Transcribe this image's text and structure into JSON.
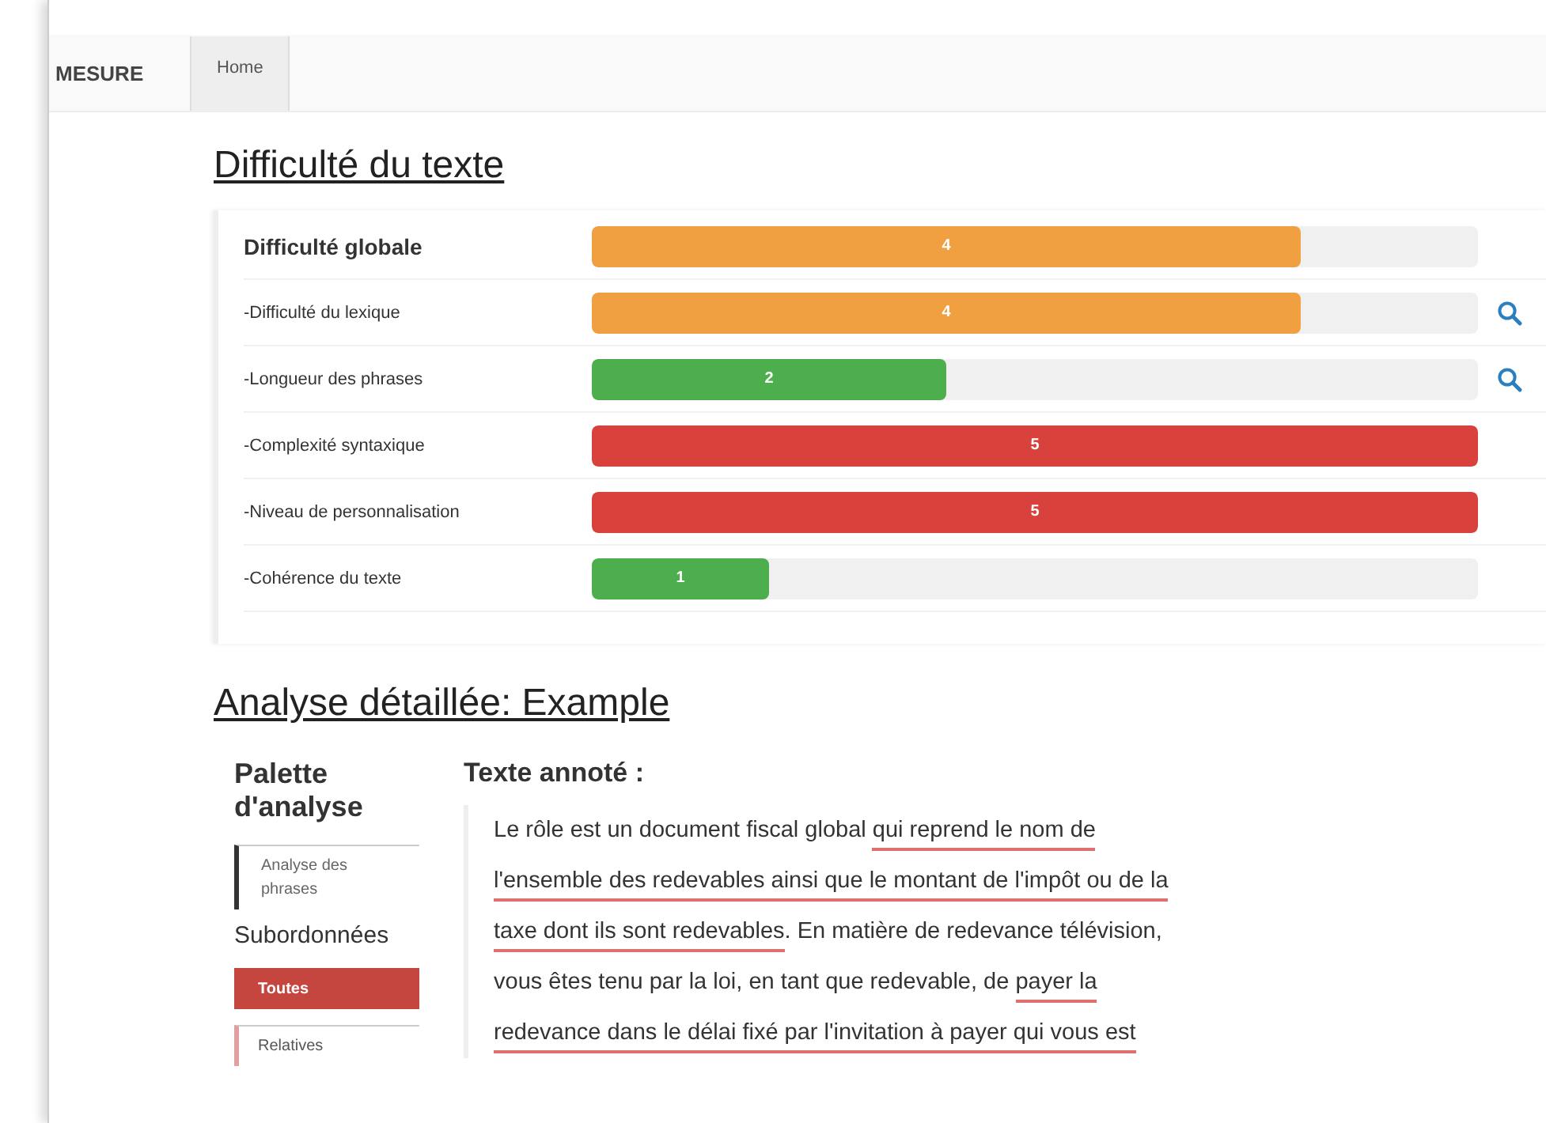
{
  "nav": {
    "brand": "MESURE",
    "tabs": [
      {
        "label": "Home",
        "selected": true
      }
    ]
  },
  "difficulty": {
    "title": "Difficulté du texte",
    "rows": [
      {
        "label": "Difficulté globale",
        "kind": "main",
        "value": "4",
        "level": 0.8,
        "color": "#f0a040",
        "search": false
      },
      {
        "label": "-Difficulté du lexique",
        "kind": "sub",
        "value": "4",
        "level": 0.8,
        "color": "#f0a040",
        "search": true
      },
      {
        "label": "-Longueur des phrases",
        "kind": "sub",
        "value": "2",
        "level": 0.4,
        "color": "#4cae4c",
        "search": true
      },
      {
        "label": "-Complexité syntaxique",
        "kind": "sub",
        "value": "5",
        "level": 1,
        "color": "#d9413c",
        "search": false
      },
      {
        "label": "-Niveau de personnalisation",
        "kind": "sub",
        "value": "5",
        "level": 1,
        "color": "#d9413c",
        "search": false
      },
      {
        "label": "-Cohérence du texte",
        "kind": "sub",
        "value": "1",
        "level": 0.2,
        "color": "#4cae4c",
        "search": false
      }
    ]
  },
  "analysis": {
    "title": "Analyse détaillée: Example",
    "palette": {
      "title": "Palette d'analyse",
      "modes": [
        {
          "label": "Analyse des phrases",
          "selected": false
        }
      ],
      "subtitle": "Subordonnées",
      "filters": [
        {
          "label": "Toutes",
          "selected": true
        },
        {
          "label": "Relatives",
          "selected": false
        }
      ]
    },
    "annotated": {
      "title": "Texte annoté :",
      "segments": [
        {
          "text": "Le rôle est un document fiscal global ",
          "underlined": false
        },
        {
          "text": "qui reprend le nom de l'ensemble des redevables ainsi que le montant de l'impôt ou de la taxe dont ils sont redevables",
          "underlined": true
        },
        {
          "text": ". En matière de redevance télévision, vous êtes tenu par la loi, en tant que redevable, de ",
          "underlined": false
        },
        {
          "text": "payer la redevance dans le délai fixé par l'invitation à payer qui vous est",
          "underlined": true
        }
      ]
    }
  }
}
